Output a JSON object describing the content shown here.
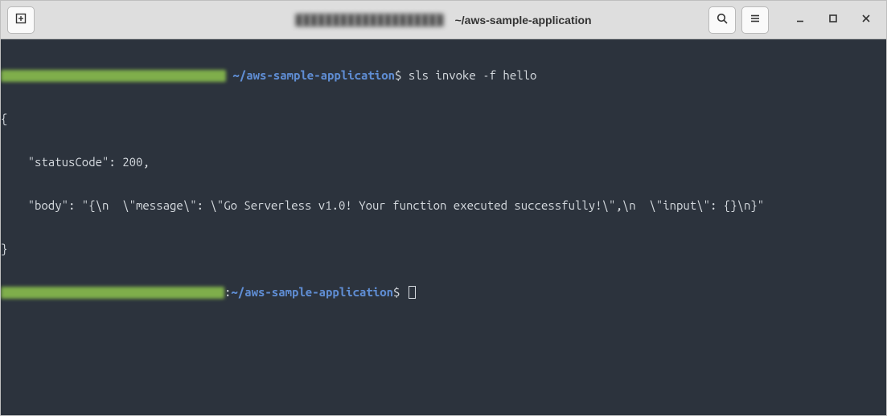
{
  "titlebar": {
    "redacted_hint": "hidden user@host",
    "title": "~/aws-sample-application"
  },
  "terminal": {
    "path": "~/aws-sample-application",
    "prompt": "$",
    "separator": ":",
    "command": "sls invoke -f hello",
    "output_lines": [
      "{",
      "    \"statusCode\": 200,",
      "    \"body\": \"{\\n  \\\"message\\\": \\\"Go Serverless v1.0! Your function executed successfully!\\\",\\n  \\\"input\\\": {}\\n}\"",
      "}"
    ]
  },
  "icons": {
    "new_tab": "new-tab-icon",
    "search": "search-icon",
    "menu": "hamburger-menu-icon",
    "minimize": "window-minimize-icon",
    "maximize": "window-maximize-icon",
    "close": "window-close-icon"
  }
}
